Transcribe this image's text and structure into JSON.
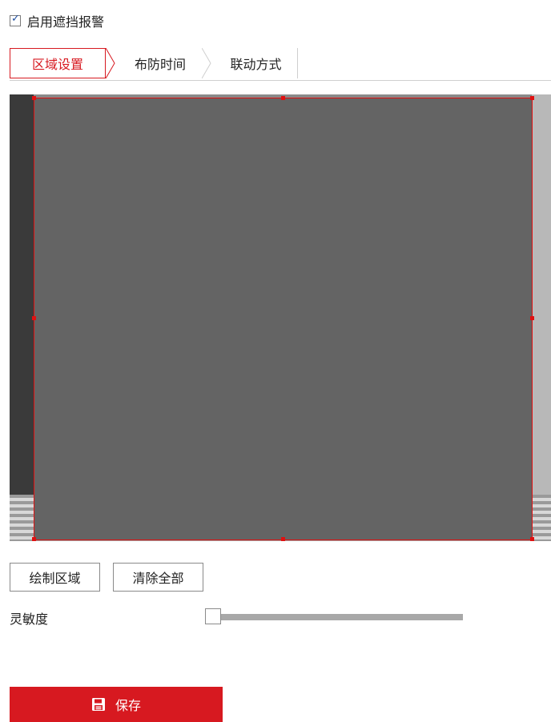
{
  "enable": {
    "label": "启用遮挡报警",
    "checked": true
  },
  "tabs": [
    {
      "label": "区域设置",
      "active": true
    },
    {
      "label": "布防时间",
      "active": false
    },
    {
      "label": "联动方式",
      "active": false
    }
  ],
  "buttons": {
    "draw_label": "绘制区域",
    "clear_label": "清除全部"
  },
  "sensitivity": {
    "label": "灵敏度",
    "value_fraction": 0
  },
  "save": {
    "label": "保存",
    "icon": "save-icon"
  },
  "colors": {
    "accent": "#d71920",
    "mask_fill": "#646464",
    "mask_border": "#e01010"
  }
}
